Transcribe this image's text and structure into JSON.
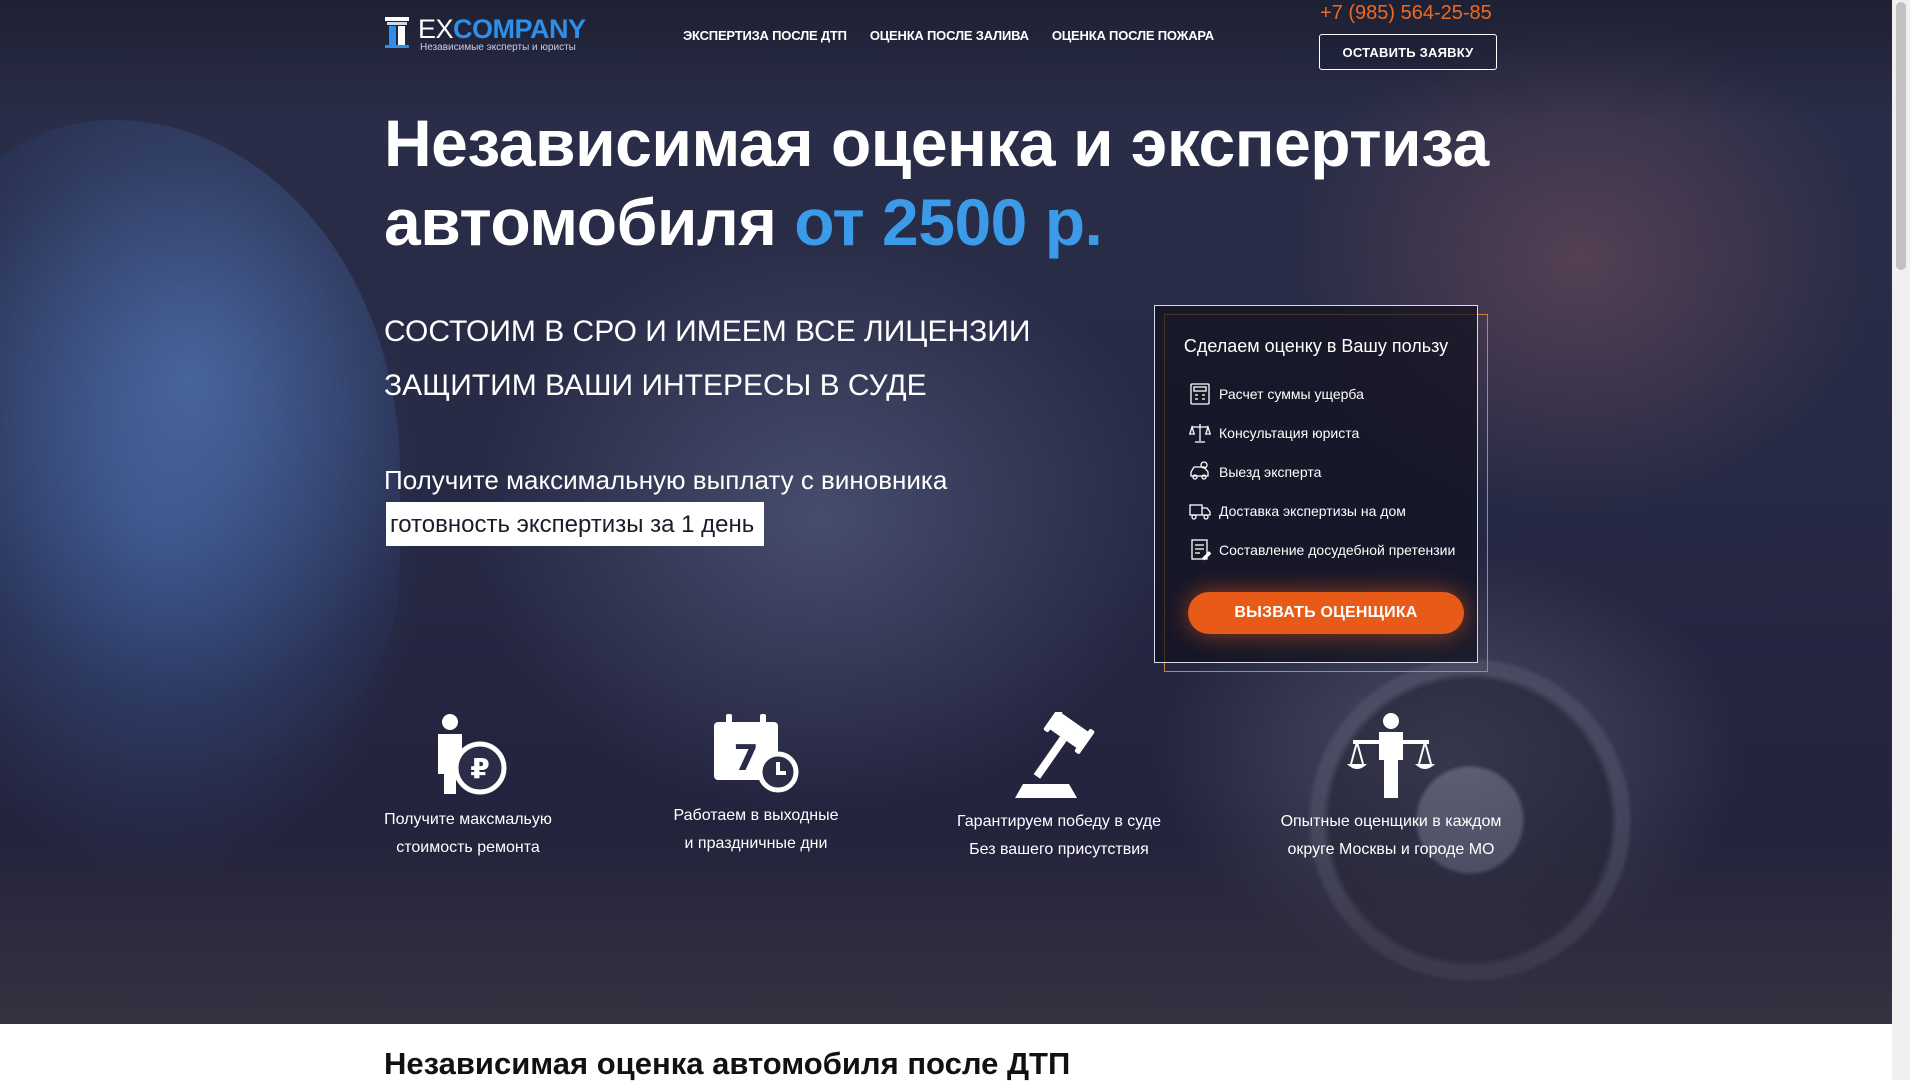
{
  "brand": {
    "name_part1": "EX",
    "name_part2": "COMPANY",
    "tagline": "Независимые эксперты и юристы",
    "accent_color": "#2f8ee8"
  },
  "nav": {
    "items": [
      {
        "label": "ЭКСПЕРТИЗА ПОСЛЕ ДТП"
      },
      {
        "label": "ОЦЕНКА ПОСЛЕ ЗАЛИВА"
      },
      {
        "label": "ОЦЕНКА ПОСЛЕ ПОЖАРА"
      }
    ]
  },
  "header": {
    "phone": "+7 (985) 564-25-85",
    "cta_label": "ОСТАВИТЬ ЗАЯВКУ",
    "phone_color": "#ee6a1f"
  },
  "hero": {
    "headline_line1": "Независимая оценка и экспертиза",
    "headline_line2": "автомобиля",
    "headline_price": "от 2500 р.",
    "line_sro": "СОСТОИМ В СРО И ИМЕЕМ ВСЕ ЛИЦЕНЗИИ",
    "line_court": "ЗАЩИТИМ ВАШИ ИНТЕРЕСЫ В СУДЕ",
    "line_payout": "Получите максимальную выплату с виновника",
    "badge": "готовность экспертизы за 1 день"
  },
  "offer_card": {
    "title": "Сделаем оценку в Вашу пользу",
    "items": [
      {
        "icon": "calculator-icon",
        "label": "Расчет суммы ущерба"
      },
      {
        "icon": "scales-icon",
        "label": "Консультация юриста"
      },
      {
        "icon": "car-icon",
        "label": "Выезд эксперта"
      },
      {
        "icon": "truck-icon",
        "label": "Доставка экспертизы на дом"
      },
      {
        "icon": "document-icon",
        "label": "Составление досудебной претензии"
      }
    ],
    "button_label": "ВЫЗВАТЬ ОЦЕНЩИКА",
    "button_color": "#e85a17"
  },
  "features": [
    {
      "icon": "ruble-person-icon",
      "line1": "Получите максмальую",
      "line2": "стоимость ремонта"
    },
    {
      "icon": "calendar-clock-icon",
      "calendar_number": "7",
      "line1": "Работаем в выходные",
      "line2": "и праздничные дни"
    },
    {
      "icon": "gavel-icon",
      "line1": "Гарантируем победу в суде",
      "line2": "Без вашего присутствия"
    },
    {
      "icon": "expert-scales-icon",
      "line1": "Опытные оценщики в каждом",
      "line2": "округе Москвы и городе МО"
    }
  ],
  "section": {
    "title": "Независимая оценка автомобиля после ДТП"
  }
}
